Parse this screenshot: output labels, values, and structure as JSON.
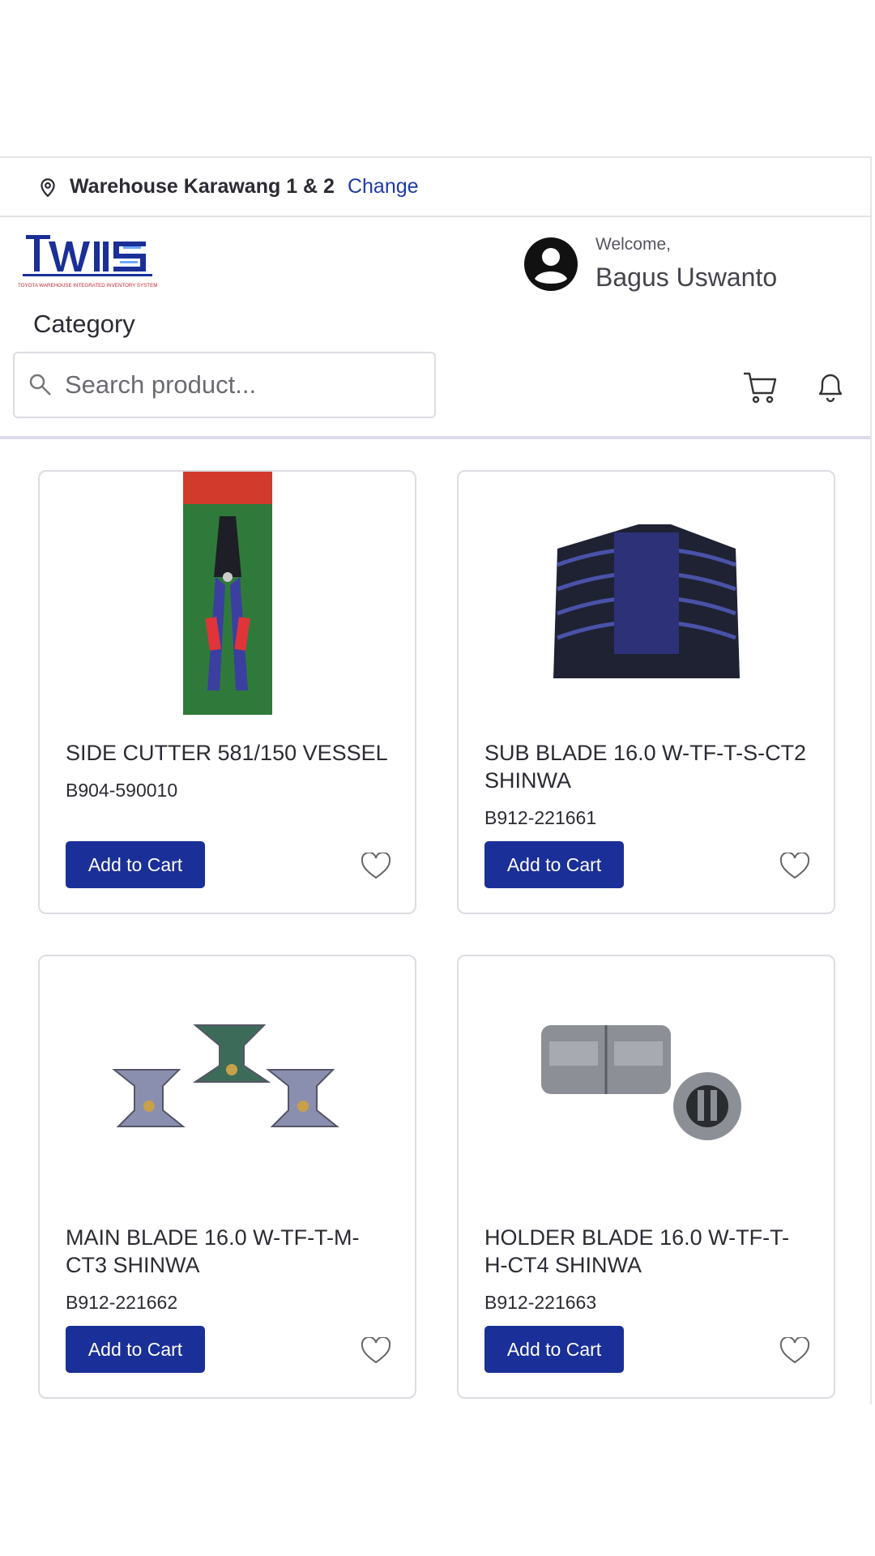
{
  "location": {
    "warehouse": "Warehouse Karawang 1 & 2",
    "change_label": "Change"
  },
  "header": {
    "logo_text": "TWIIS",
    "logo_tagline": "TOYOTA WAREHOUSE INTEGRATED INVENTORY SYSTEM",
    "welcome": "Welcome,",
    "user_name": "Bagus Uswanto",
    "category_label": "Category"
  },
  "search": {
    "placeholder": "Search product..."
  },
  "colors": {
    "accent": "#1a2f97",
    "link": "#1e3aa8",
    "border": "#dcdce2"
  },
  "products": [
    {
      "title": "SIDE CUTTER 581/150 VESSEL",
      "code": "B904-590010",
      "button": "Add to Cart",
      "image": "side-cutter"
    },
    {
      "title": "SUB BLADE 16.0 W-TF-T-S-CT2 SHINWA",
      "code": "B912-221661",
      "button": "Add to Cart",
      "image": "sub-blade"
    },
    {
      "title": "MAIN BLADE 16.0 W-TF-T-M-CT3 SHINWA",
      "code": "B912-221662",
      "button": "Add to Cart",
      "image": "main-blade"
    },
    {
      "title": "HOLDER BLADE 16.0 W-TF-T-H-CT4 SHINWA",
      "code": "B912-221663",
      "button": "Add to Cart",
      "image": "holder-blade"
    }
  ]
}
